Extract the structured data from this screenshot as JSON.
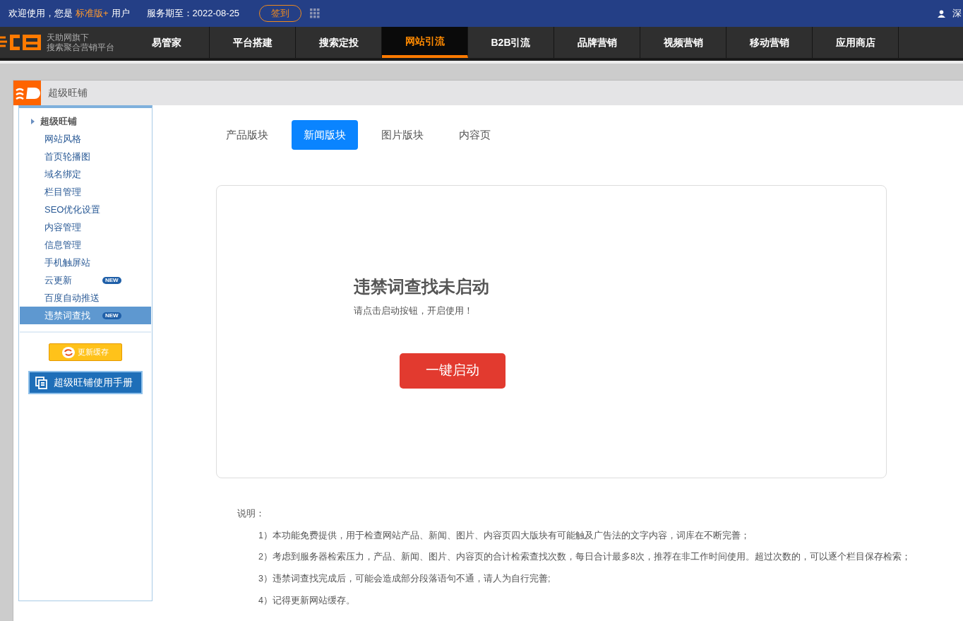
{
  "top_bar": {
    "welcome": "欢迎使用，您是",
    "edition": "标准版+",
    "user_suffix": "用户",
    "service": "服务期至：2022-08-25",
    "checkin": "签到",
    "user": "深"
  },
  "brand": {
    "line1": "天助网旗下",
    "line2": "搜索聚合营销平台"
  },
  "nav": [
    {
      "label": "易管家",
      "selected": false
    },
    {
      "label": "平台搭建",
      "selected": false
    },
    {
      "label": "搜索定投",
      "selected": false
    },
    {
      "label": "网站引流",
      "selected": true
    },
    {
      "label": "B2B引流",
      "selected": false
    },
    {
      "label": "品牌营销",
      "selected": false
    },
    {
      "label": "视频营销",
      "selected": false
    },
    {
      "label": "移动营销",
      "selected": false
    },
    {
      "label": "应用商店",
      "selected": false
    }
  ],
  "panel_title": "超级旺铺",
  "sidebar": {
    "heading": "超级旺铺",
    "items": [
      {
        "label": "网站风格",
        "selected": false
      },
      {
        "label": "首页轮播图",
        "selected": false
      },
      {
        "label": "域名绑定",
        "selected": false
      },
      {
        "label": "栏目管理",
        "selected": false
      },
      {
        "label": "SEO优化设置",
        "selected": false
      },
      {
        "label": "内容管理",
        "selected": false
      },
      {
        "label": "信息管理",
        "selected": false
      },
      {
        "label": "手机触屏站",
        "selected": false
      },
      {
        "label": "云更新",
        "selected": false,
        "badge": "NEW"
      },
      {
        "label": "百度自动推送",
        "selected": false
      },
      {
        "label": "违禁词查找",
        "selected": true,
        "badge": "NEW"
      }
    ],
    "refresh_button": "更新缓存",
    "manual_button": "超级旺铺使用手册"
  },
  "tabs": [
    {
      "label": "产品版块",
      "selected": false
    },
    {
      "label": "新闻版块",
      "selected": true
    },
    {
      "label": "图片版块",
      "selected": false
    },
    {
      "label": "内容页",
      "selected": false
    }
  ],
  "card": {
    "title": "违禁词查找未启动",
    "subtitle": "请点击启动按钮，开启使用！",
    "button": "一键启动"
  },
  "notes": {
    "heading": "说明：",
    "items": [
      "1）本功能免费提供，用于检查网站产品、新闻、图片、内容页四大版块有可能触及广告法的文字内容，词库在不断完善；",
      "2）考虑到服务器检索压力，产品、新闻、图片、内容页的合计检索查找次数，每日合计最多8次，推荐在非工作时间使用。超过次数的，可以逐个栏目保存检索；",
      "3）违禁词查找完成后，可能会造成部分段落语句不通，请人为自行完善;",
      "4）记得更新网站缓存。"
    ]
  }
}
